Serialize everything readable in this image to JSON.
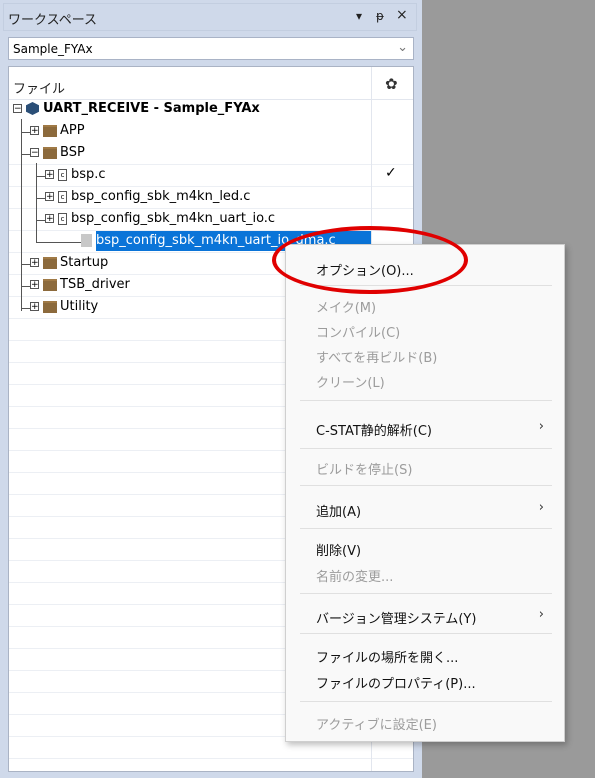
{
  "workspace": {
    "title": "ワークスペース",
    "dropdown_icon": "▾",
    "pin_icon": "ᵽ",
    "close_icon": "×",
    "config_select": {
      "value": "Sample_FYAx"
    }
  },
  "tree": {
    "header": "ファイル",
    "gear_icon": "✿",
    "check_icon": "✓",
    "project": "UART_RECEIVE - Sample_FYAx",
    "nodes": {
      "app": "APP",
      "bsp": "BSP",
      "bsp_c": "bsp.c",
      "led": "bsp_config_sbk_m4kn_led.c",
      "uart_io": "bsp_config_sbk_m4kn_uart_io.c",
      "uart_dma": "bsp_config_sbk_m4kn_uart_io_dma.c",
      "startup": "Startup",
      "tsb_driver": "TSB_driver",
      "utility": "Utility"
    }
  },
  "menu": {
    "options": "オプション(O)...",
    "make": "メイク(M)",
    "compile": "コンパイル(C)",
    "rebuild_all": "すべてを再ビルド(B)",
    "clean": "クリーン(L)",
    "cstat": "C-STAT静的解析(C)",
    "stop_build": "ビルドを停止(S)",
    "add": "追加(A)",
    "remove": "削除(V)",
    "rename": "名前の変更...",
    "version_control": "バージョン管理システム(Y)",
    "open_location": "ファイルの場所を開く...",
    "file_properties": "ファイルのプロパティ(P)...",
    "set_active": "アクティブに設定(E)",
    "submenu_arrow": "›"
  },
  "colors": {
    "selection": "#0a74d8",
    "annotation": "#e00000",
    "panel_bg": "#cfd9ea"
  }
}
